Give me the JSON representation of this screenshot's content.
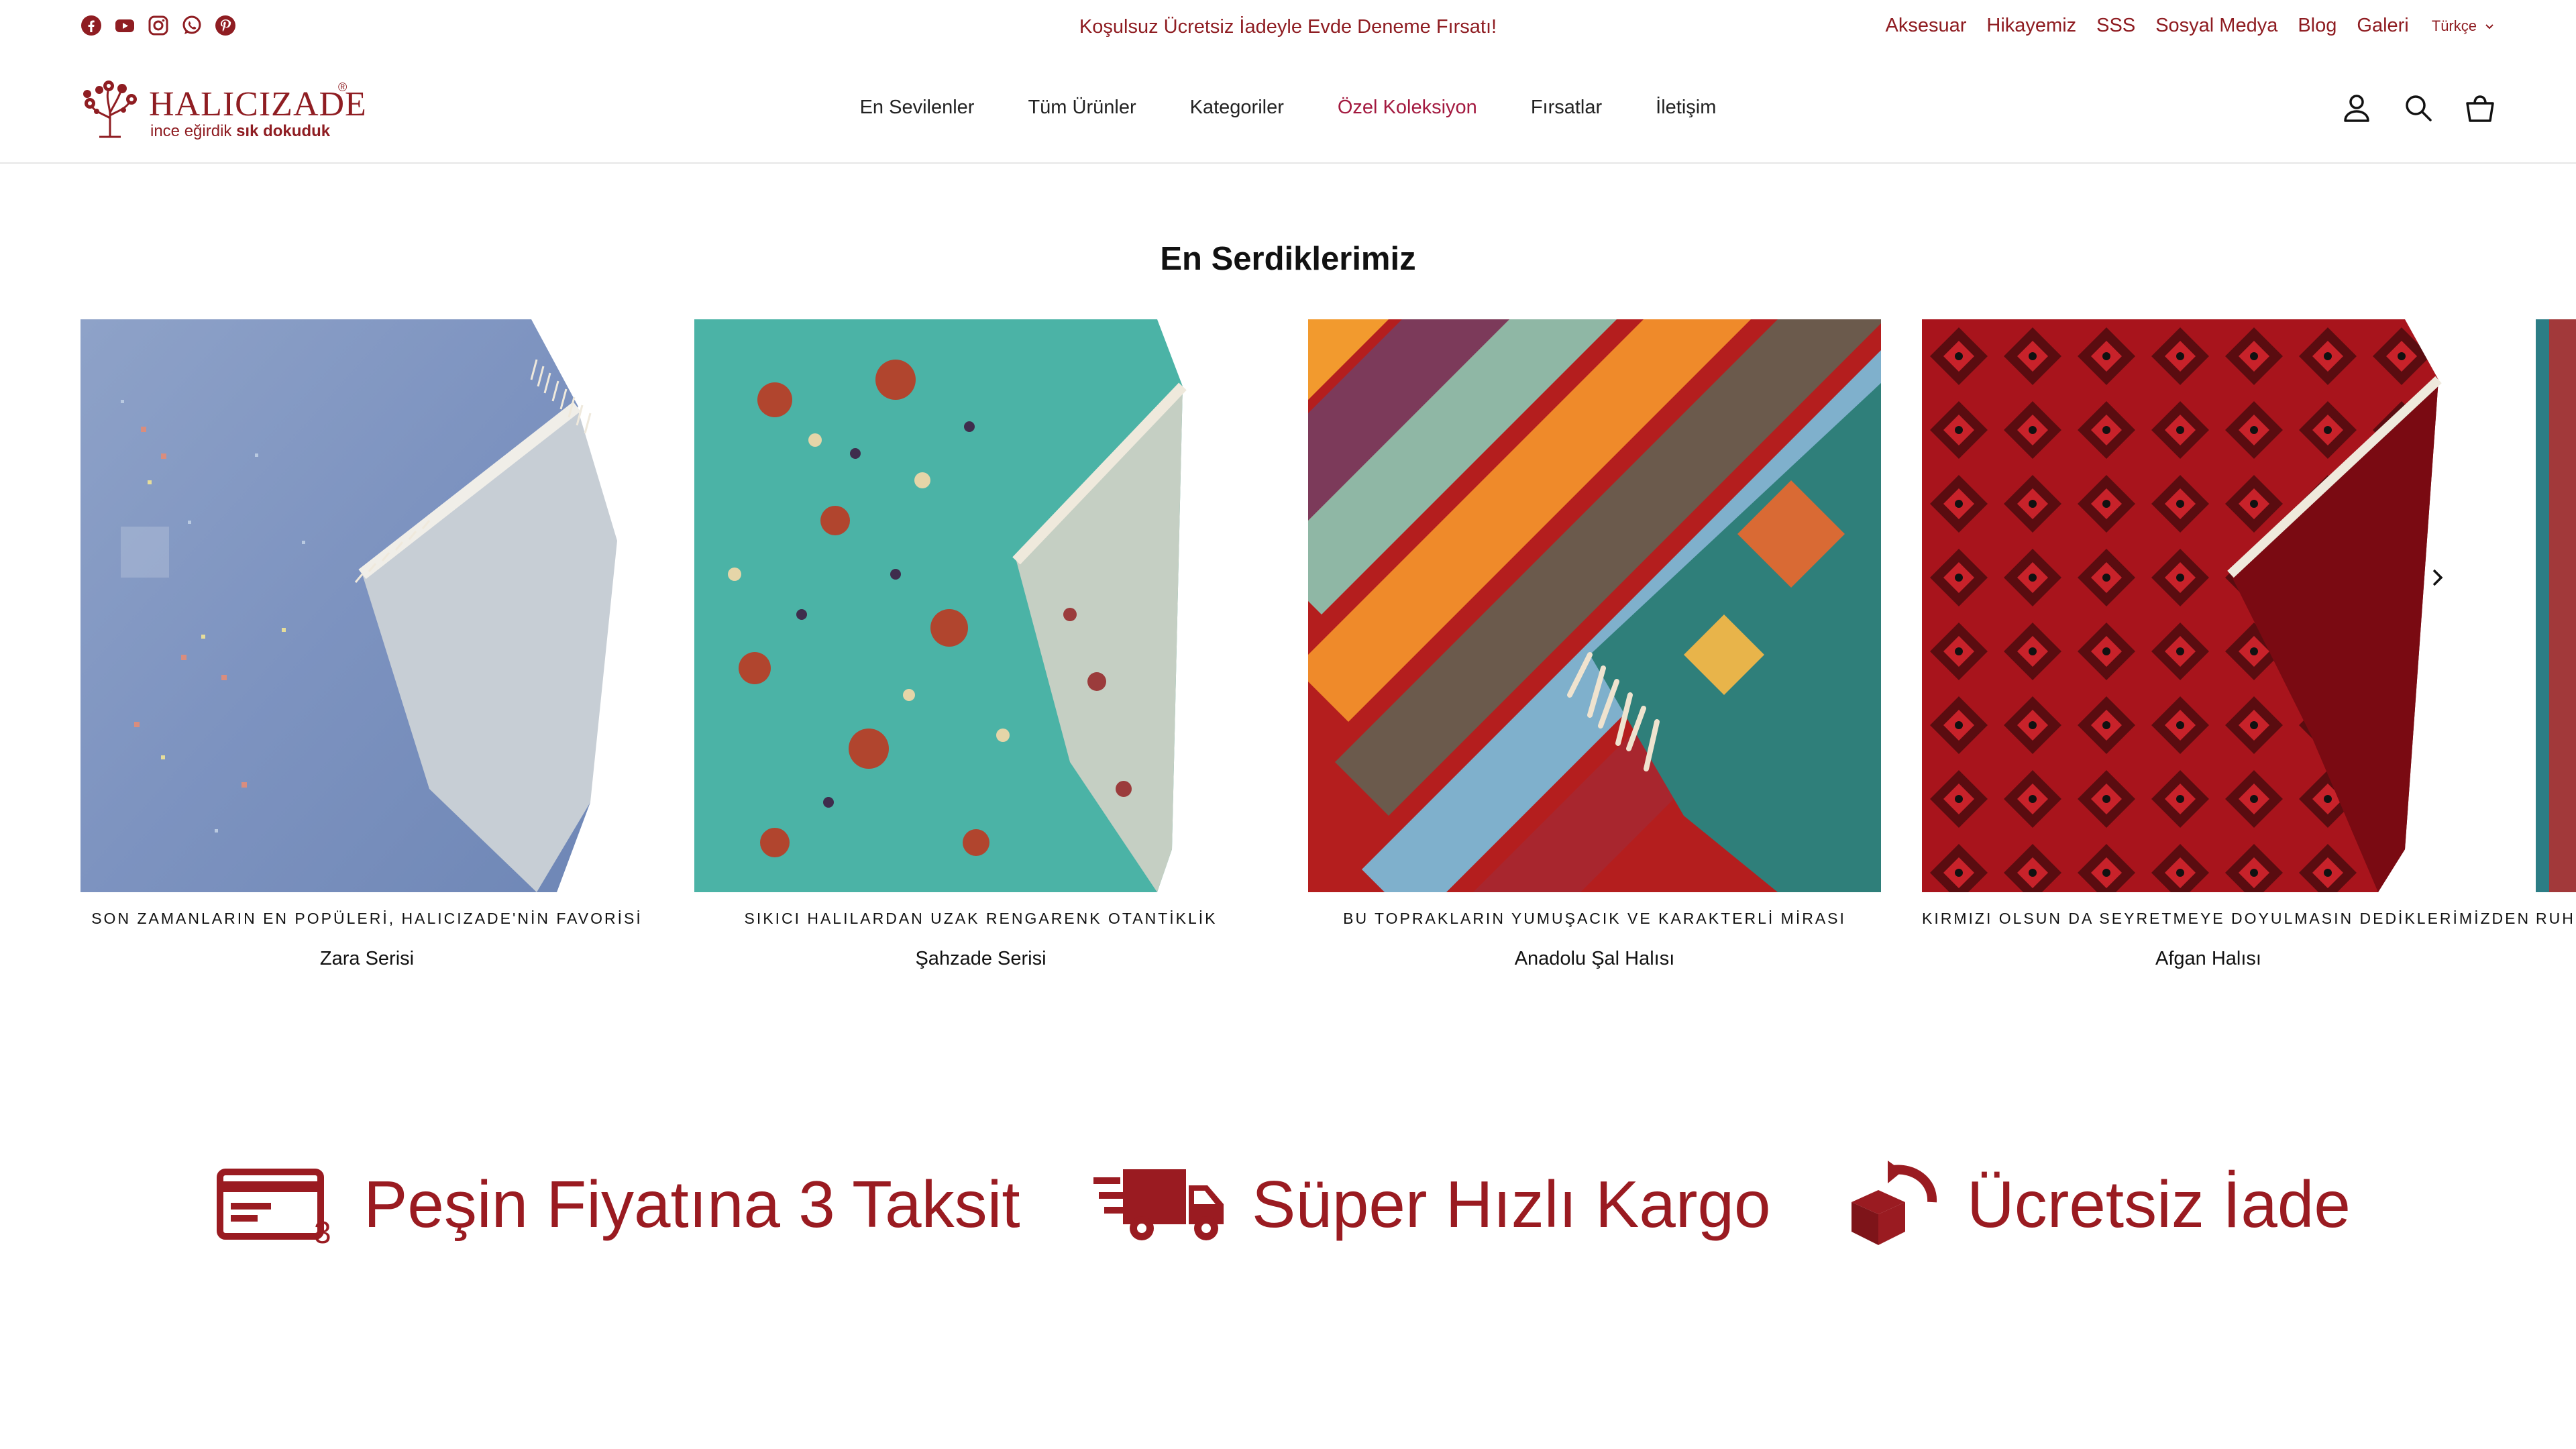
{
  "announcement": "Koşulsuz Ücretsiz İadeyle Evde Deneme Fırsatı!",
  "social_icons": [
    "facebook-icon",
    "youtube-icon",
    "instagram-icon",
    "whatsapp-icon",
    "pinterest-icon"
  ],
  "top_links": [
    "Aksesuar",
    "Hikayemiz",
    "SSS",
    "Sosyal Medya",
    "Blog",
    "Galeri"
  ],
  "language": "Türkçe",
  "logo": {
    "brand": "HALICIZADE",
    "registered": "®",
    "slogan_light": "ince eğirdik",
    "slogan_bold": "sık dokuduk"
  },
  "nav": {
    "items": [
      "En Sevilenler",
      "Tüm Ürünler",
      "Kategoriler",
      "Özel Koleksiyon",
      "Fırsatlar",
      "İletişim"
    ],
    "active": "Özel Koleksiyon"
  },
  "header_icons": [
    "account-icon",
    "search-icon",
    "cart-icon"
  ],
  "section_title": "En Serdiklerimiz",
  "products": [
    {
      "tagline": "SON ZAMANLARIN EN POPÜLERİ, HALICIZADE'NİN FAVORİSİ",
      "name": "Zara Serisi"
    },
    {
      "tagline": "SIKICI HALILARDAN UZAK RENGARENK OTANTİKLİK",
      "name": "Şahzade Serisi"
    },
    {
      "tagline": "BU TOPRAKLARIN YUMUŞACIK VE KARAKTERLİ MİRASI",
      "name": "Anadolu Şal Halısı"
    },
    {
      "tagline": "KIRMIZI OLSUN DA SEYRETMEYE DOYULMASIN DEDİKLERİMİZDEN",
      "name": "Afgan Halısı"
    },
    {
      "tagline": "RUH",
      "name": ""
    }
  ],
  "features": [
    {
      "icon": "credit-card-installment-icon",
      "label": "Peşin Fiyatına 3 Taksit"
    },
    {
      "icon": "fast-delivery-truck-icon",
      "label": "Süper Hızlı Kargo"
    },
    {
      "icon": "free-return-box-icon",
      "label": "Ücretsiz İade"
    }
  ],
  "colors": {
    "brand": "#8f1d22",
    "nav_active": "#a3193f",
    "feature_red": "#9a1b21"
  }
}
